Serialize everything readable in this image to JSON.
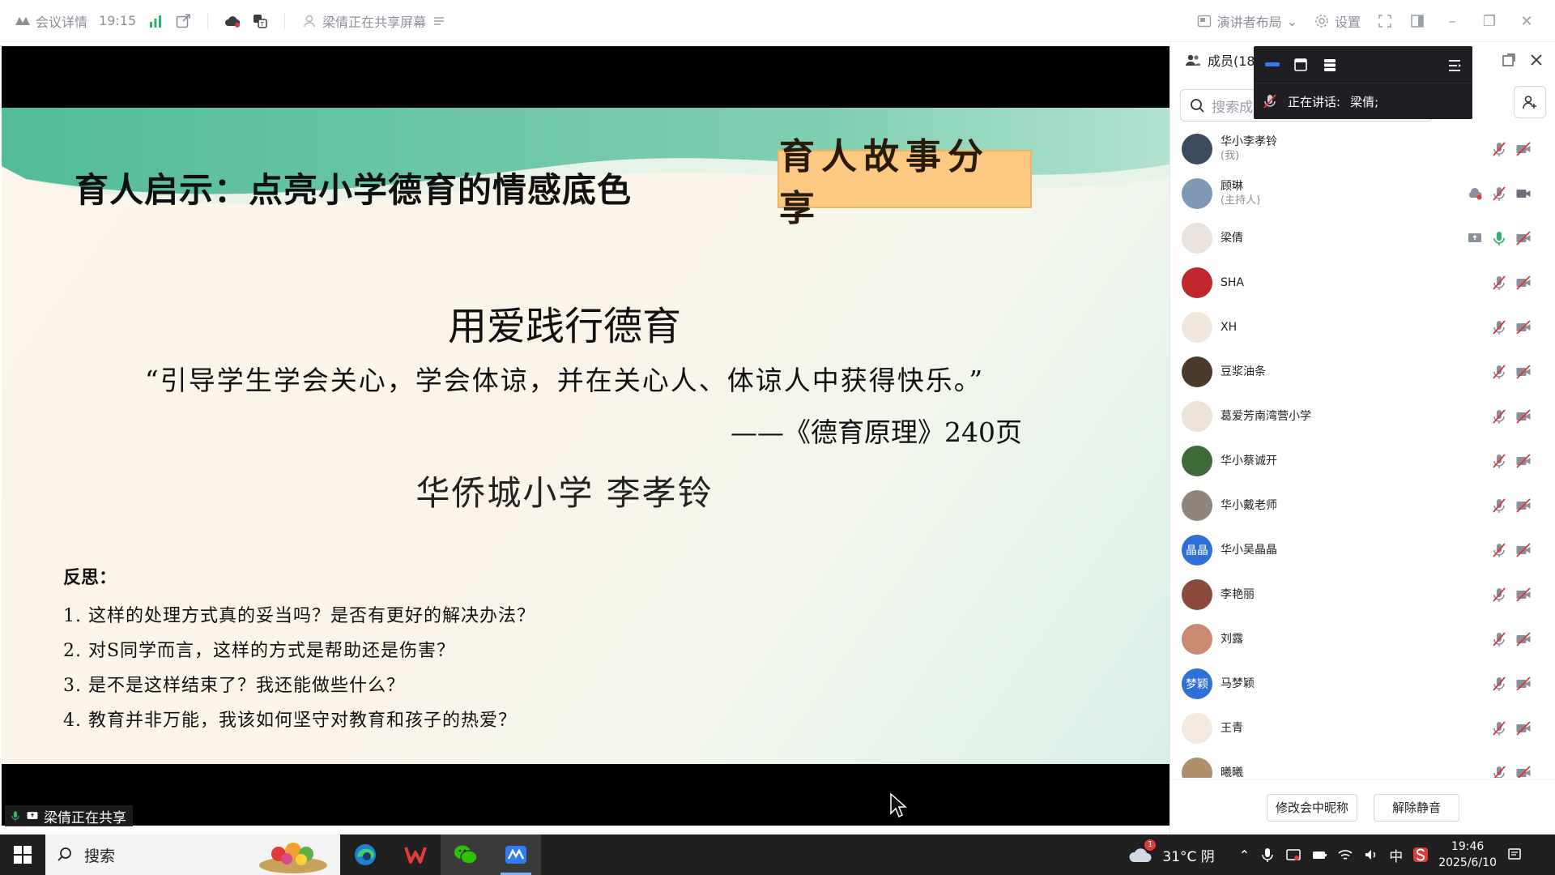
{
  "topbar": {
    "meeting_details": "会议详情",
    "time": "19:15",
    "sharing_status": "梁倩正在共享屏幕",
    "layout": "演讲者布局",
    "settings": "设置"
  },
  "slide": {
    "title": "育人启示：点亮小学德育的情感底色",
    "badge": "育人故事分享",
    "heading": "用爱践行德育",
    "quote": "“引导学生学会关心，学会体谅，并在关心人、体谅人中获得快乐。”",
    "source": "——《德育原理》240页",
    "author": "华侨城小学  李孝铃",
    "reflection_title": "反思：",
    "reflections": [
      "1. 这样的处理方式真的妥当吗？是否有更好的解决办法？",
      "2. 对S同学而言，这样的方式是帮助还是伤害？",
      "3. 是不是这样结束了？我还能做些什么？",
      "4. 教育并非万能，我该如何坚守对教育和孩子的热爱？"
    ]
  },
  "sharing_tag": "梁倩正在共享",
  "panel": {
    "title": "成员(18)",
    "search_placeholder": "搜索成",
    "speaking_label": "正在讲话:",
    "speaking_name": "梁倩;",
    "members": [
      {
        "name": "华小李孝铃",
        "role": "(我)",
        "avatar_color": "#3b4a5c",
        "avatar_text": ""
      },
      {
        "name": "顾琳",
        "role": "(主持人)",
        "avatar_color": "#7f98b3",
        "avatar_text": ""
      },
      {
        "name": "梁倩",
        "role": "",
        "avatar_color": "#e9e2dd",
        "avatar_text": ""
      },
      {
        "name": "SHA",
        "role": "",
        "avatar_color": "#c0262d",
        "avatar_text": ""
      },
      {
        "name": "XH",
        "role": "",
        "avatar_color": "#f1e6db",
        "avatar_text": ""
      },
      {
        "name": "豆浆油条",
        "role": "",
        "avatar_color": "#4a3a2a",
        "avatar_text": ""
      },
      {
        "name": "葛爱芳南湾营小学",
        "role": "",
        "avatar_color": "#ede2d6",
        "avatar_text": ""
      },
      {
        "name": "华小蔡诚开",
        "role": "",
        "avatar_color": "#3f6b3a",
        "avatar_text": ""
      },
      {
        "name": "华小戴老师",
        "role": "",
        "avatar_color": "#8f8578",
        "avatar_text": ""
      },
      {
        "name": "华小吴晶晶",
        "role": "",
        "avatar_color": "#2f6fd6",
        "avatar_text": "晶晶"
      },
      {
        "name": "李艳丽",
        "role": "",
        "avatar_color": "#8a4a3c",
        "avatar_text": ""
      },
      {
        "name": "刘露",
        "role": "",
        "avatar_color": "#c98a72",
        "avatar_text": ""
      },
      {
        "name": "马梦颖",
        "role": "",
        "avatar_color": "#2f6fd6",
        "avatar_text": "梦颖"
      },
      {
        "name": "王青",
        "role": "",
        "avatar_color": "#f3e9df",
        "avatar_text": ""
      },
      {
        "name": "曦曦",
        "role": "",
        "avatar_color": "#b08e6c",
        "avatar_text": ""
      }
    ],
    "rename_button": "修改会中昵称",
    "unmute_button": "解除静音"
  },
  "taskbar": {
    "search": "搜索",
    "weather": "31°C 阴",
    "ime": "中",
    "time": "19:46",
    "date": "2025/6/10",
    "weather_badge": "1"
  },
  "colors": {
    "accent": "#2f6fd6",
    "badge_bg": "#fcc983",
    "band_green": "#5fc1a1",
    "mic_on": "#2db36b",
    "muted": "#d9363e"
  }
}
